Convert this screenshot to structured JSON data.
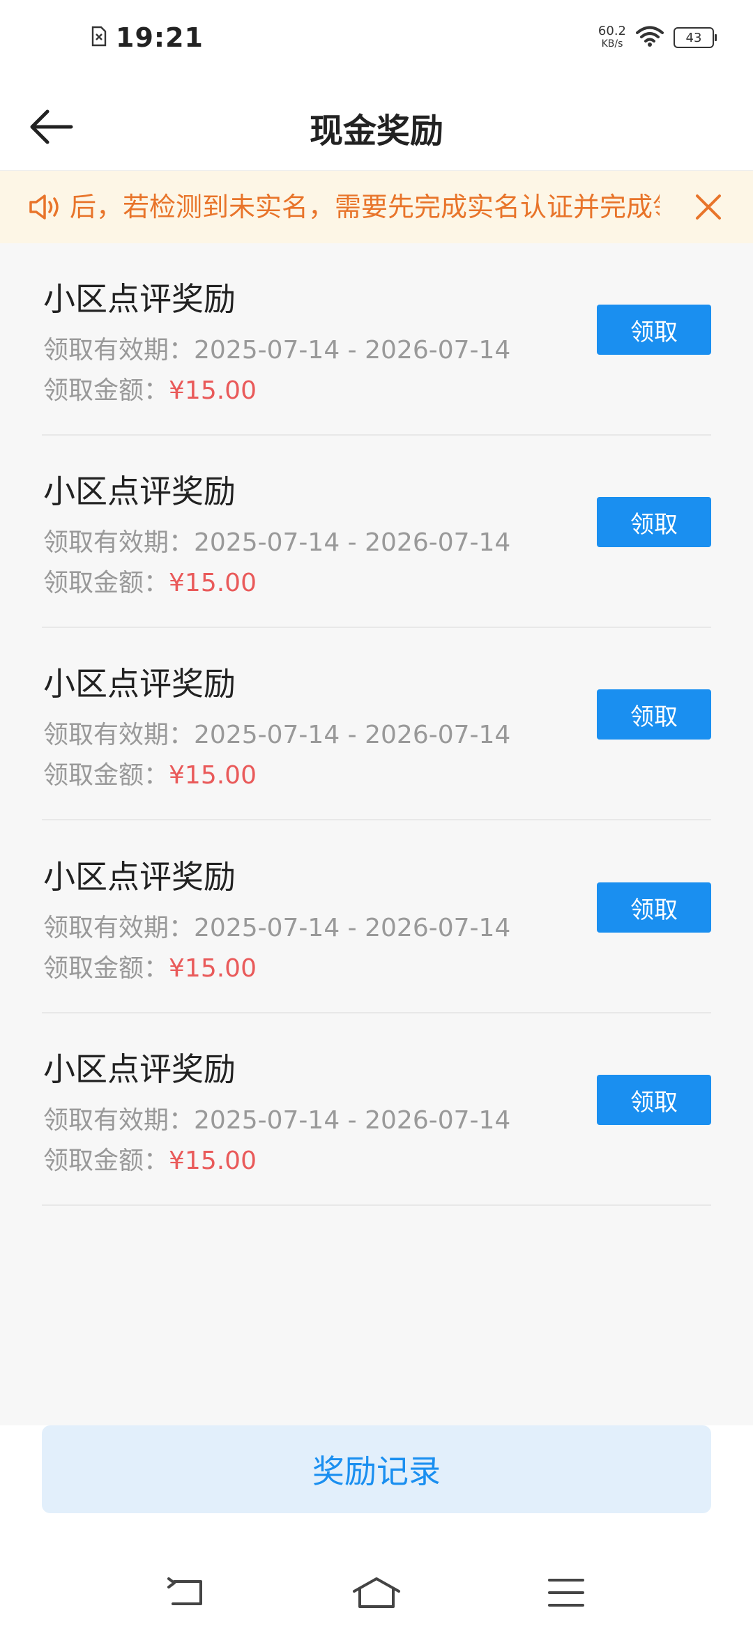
{
  "status_bar": {
    "time": "19:21",
    "net_speed_value": "60.2",
    "net_speed_unit": "KB/s",
    "battery": "43"
  },
  "header": {
    "title": "现金奖励"
  },
  "notice": {
    "text": "后，若检测到未实名，需要先完成实名认证并完成领取",
    "accent_color": "#e8742a"
  },
  "rewards": [
    {
      "title": "小区点评奖励",
      "period_label": "领取有效期：",
      "period": "2025-07-14 - 2026-07-14",
      "amount_label": "领取金额：",
      "amount": "¥15.00",
      "button": "领取"
    },
    {
      "title": "小区点评奖励",
      "period_label": "领取有效期：",
      "period": "2025-07-14 - 2026-07-14",
      "amount_label": "领取金额：",
      "amount": "¥15.00",
      "button": "领取"
    },
    {
      "title": "小区点评奖励",
      "period_label": "领取有效期：",
      "period": "2025-07-14 - 2026-07-14",
      "amount_label": "领取金额：",
      "amount": "¥15.00",
      "button": "领取"
    },
    {
      "title": "小区点评奖励",
      "period_label": "领取有效期：",
      "period": "2025-07-14 - 2026-07-14",
      "amount_label": "领取金额：",
      "amount": "¥15.00",
      "button": "领取"
    },
    {
      "title": "小区点评奖励",
      "period_label": "领取有效期：",
      "period": "2025-07-14 - 2026-07-14",
      "amount_label": "领取金额：",
      "amount": "¥15.00",
      "button": "领取"
    }
  ],
  "footer": {
    "record_button": "奖励记录"
  },
  "colors": {
    "primary": "#1a8ff0",
    "amount": "#e95a5a",
    "notice_bg": "#fdf6e6"
  }
}
